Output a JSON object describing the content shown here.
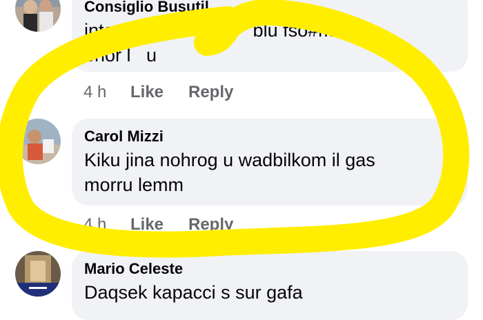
{
  "comments": [
    {
      "author": "Consiglio Busutil",
      "text_line1": "intom l                      blu fso#m had",
      "text_line2": "ohor l   u",
      "time": "4 h",
      "like_label": "Like",
      "reply_label": "Reply"
    },
    {
      "author": "Carol Mizzi",
      "text_line1": "Kiku jina nohrog u wadbilkom il gas",
      "text_line2": "morru lemm",
      "time": "4 h",
      "like_label": "Like",
      "reply_label": "Reply"
    },
    {
      "author": "Mario Celeste",
      "text_line1": "Daqsek kapacci s sur gafa"
    }
  ],
  "colors": {
    "bubble": "#f0f2f5",
    "action_text": "#65676b",
    "highlight": "#ffee00"
  }
}
